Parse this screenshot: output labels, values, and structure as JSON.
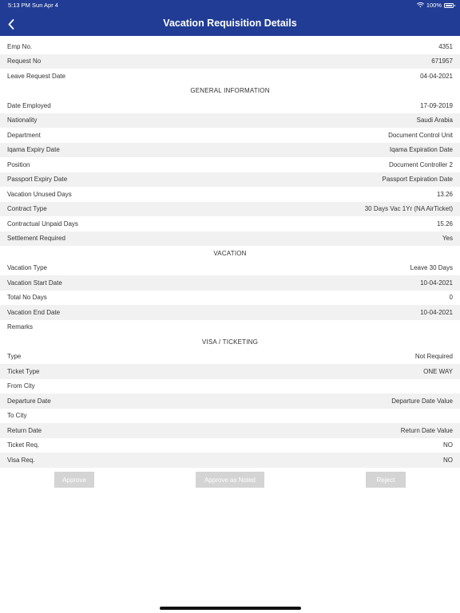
{
  "status_bar": {
    "time": "5:13 PM  Sun Apr 4",
    "battery": "100%"
  },
  "header": {
    "title": "Vacation Requisition Details"
  },
  "top_rows": [
    {
      "label": "Emp No.",
      "value": "4351"
    },
    {
      "label": "Request No",
      "value": "671957"
    },
    {
      "label": "Leave Request Date",
      "value": "04-04-2021"
    }
  ],
  "sections": {
    "general": "GENERAL INFORMATION",
    "vacation": "VACATION",
    "visa": "VISA / TICKETING"
  },
  "general_rows": [
    {
      "label": "Date Employed",
      "value": "17-09-2019"
    },
    {
      "label": "Nationality",
      "value": "Saudi Arabia"
    },
    {
      "label": "Department",
      "value": "Document Control Unit"
    },
    {
      "label": "Iqama Expiry Date",
      "value": "Iqama Expiration Date"
    },
    {
      "label": "Position",
      "value": "Document Controller 2"
    },
    {
      "label": "Passport Expiry Date",
      "value": "Passport Expiration Date"
    },
    {
      "label": "Vacation Unused Days",
      "value": "13.26"
    },
    {
      "label": "Contract Type",
      "value": "30 Days Vac 1Yr (NA AirTicket)"
    },
    {
      "label": "Contractual Unpaid Days",
      "value": "15.26"
    },
    {
      "label": "Settlement Required",
      "value": "Yes"
    }
  ],
  "vacation_rows": [
    {
      "label": "Vacation Type",
      "value": "Leave 30 Days"
    },
    {
      "label": "Vacation Start Date",
      "value": "10-04-2021"
    },
    {
      "label": "Total No Days",
      "value": "0"
    },
    {
      "label": "Vacation End Date",
      "value": "10-04-2021"
    },
    {
      "label": "Remarks",
      "value": ""
    }
  ],
  "visa_rows": [
    {
      "label": "Type",
      "value": "Not Required"
    },
    {
      "label": "Ticket Type",
      "value": "ONE WAY"
    },
    {
      "label": "From City",
      "value": ""
    },
    {
      "label": "Departure Date",
      "value": "Departure Date Value"
    },
    {
      "label": "To City",
      "value": ""
    },
    {
      "label": "Return Date",
      "value": "Return Date Value"
    },
    {
      "label": "Ticket Req.",
      "value": "NO"
    },
    {
      "label": "Visa Req.",
      "value": "NO"
    }
  ],
  "actions": {
    "approve": "Approve",
    "approve_noted": "Approve as Noted",
    "reject": "Reject"
  },
  "colors": {
    "header_bg": "#203c94",
    "row_alt": "#f1f1f1",
    "button_disabled": "#d4d4d4"
  }
}
